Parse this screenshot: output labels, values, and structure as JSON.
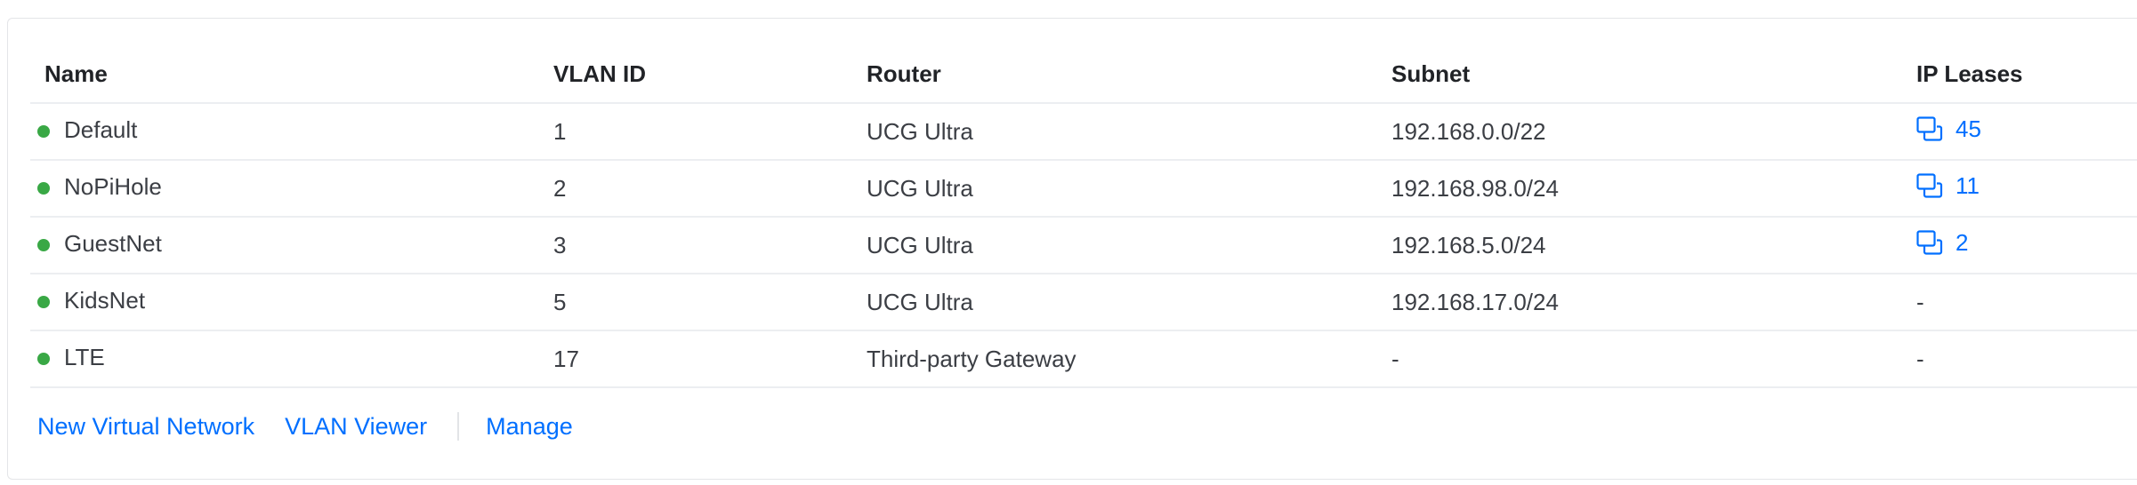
{
  "table": {
    "headers": [
      "Name",
      "VLAN ID",
      "Router",
      "Subnet",
      "IP Leases"
    ],
    "rows": [
      {
        "name": "Default",
        "vlan_id": "1",
        "router": "UCG Ultra",
        "subnet": "192.168.0.0/22",
        "ip_leases": "45",
        "has_leases": true
      },
      {
        "name": "NoPiHole",
        "vlan_id": "2",
        "router": "UCG Ultra",
        "subnet": "192.168.98.0/24",
        "ip_leases": "11",
        "has_leases": true
      },
      {
        "name": "GuestNet",
        "vlan_id": "3",
        "router": "UCG Ultra",
        "subnet": "192.168.5.0/24",
        "ip_leases": "2",
        "has_leases": true
      },
      {
        "name": "KidsNet",
        "vlan_id": "5",
        "router": "UCG Ultra",
        "subnet": "192.168.17.0/24",
        "ip_leases": "-",
        "has_leases": false
      },
      {
        "name": "LTE",
        "vlan_id": "17",
        "router": "Third-party Gateway",
        "subnet": "-",
        "ip_leases": "-",
        "has_leases": false
      }
    ]
  },
  "footer": {
    "new_network_label": "New Virtual Network",
    "vlan_viewer_label": "VLAN Viewer",
    "manage_label": "Manage"
  },
  "colors": {
    "status_online": "#39a845",
    "link": "#006fff"
  },
  "icons": {
    "status": "status-dot-online",
    "leases": "ip-leases-icon"
  }
}
